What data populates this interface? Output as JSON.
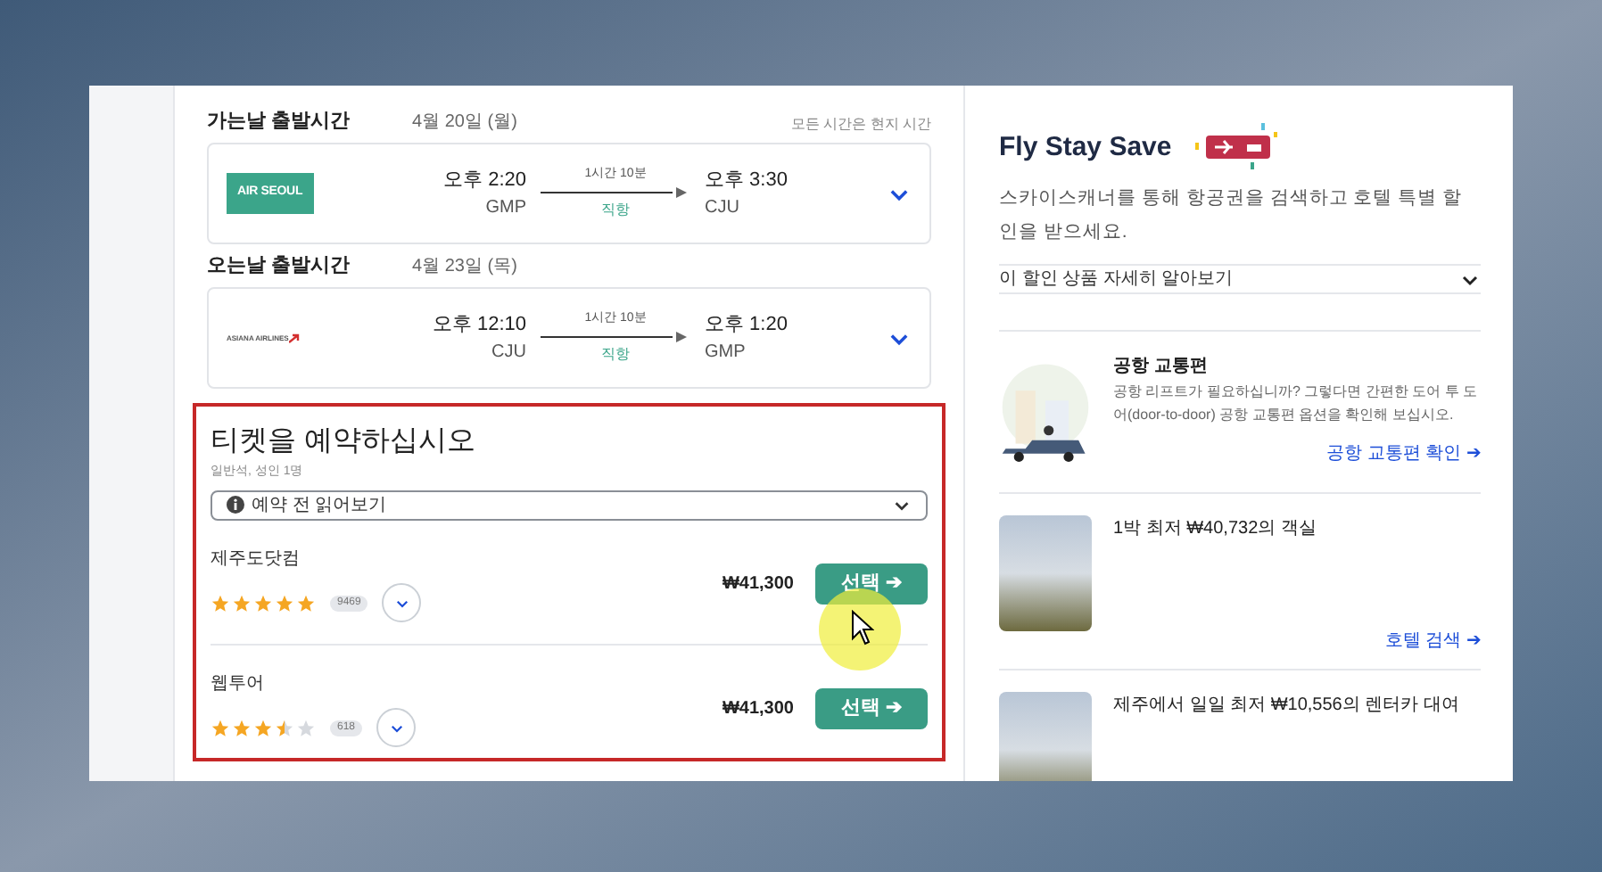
{
  "flights": [
    {
      "heading": "가는날 출발시간",
      "date": "4월 20일 (월)",
      "note": "모든 시간은 현지 시간",
      "airline": "AIR SEOUL",
      "kind": "block",
      "depart_time": "오후 2:20",
      "depart_airport": "GMP",
      "duration": "1시간 10분",
      "stops": "직항",
      "arrive_time": "오후 3:30",
      "arrive_airport": "CJU"
    },
    {
      "heading": "오는날 출발시간",
      "date": "4월 23일 (목)",
      "airline": "ASIANA AIRLINES",
      "kind": "wordmark",
      "depart_time": "오후 12:10",
      "depart_airport": "CJU",
      "duration": "1시간 10분",
      "stops": "직항",
      "arrive_time": "오후 1:20",
      "arrive_airport": "GMP"
    }
  ],
  "booking": {
    "title": "티켓을 예약하십시오",
    "subtitle": "일반석, 성인 1명",
    "dropdown": "예약 전 읽어보기",
    "offers": [
      {
        "name": "제주도닷컴",
        "stars": 5,
        "reviews": "9469",
        "price": "₩41,300",
        "button": "선택 ➔"
      },
      {
        "name": "웹투어",
        "stars": 3.5,
        "reviews": "618",
        "price": "₩41,300",
        "button": "선택 ➔"
      }
    ]
  },
  "promo": {
    "title": "Fly Stay Save",
    "description": "스카이스캐너를 통해 항공권을 검색하고 호텔 특별 할인을 받으세요.",
    "dropdown": "이 할인 상품 자세히 알아보기",
    "cards": [
      {
        "kind": "illustration",
        "title": "공항 교통편",
        "text": "공항 리프트가 필요하십니까? 그렇다면 간편한 도어 투 도어(door-to-door) 공항 교통편 옵션을 확인해 보십시오.",
        "link": "공항 교통편 확인 ➔"
      },
      {
        "kind": "photo",
        "title": "1박 최저 ₩40,732의 객실",
        "link": "호텔 검색 ➔"
      },
      {
        "kind": "photo",
        "title": "제주에서 일일 최저 ₩10,556의 렌터카 대여"
      }
    ]
  }
}
